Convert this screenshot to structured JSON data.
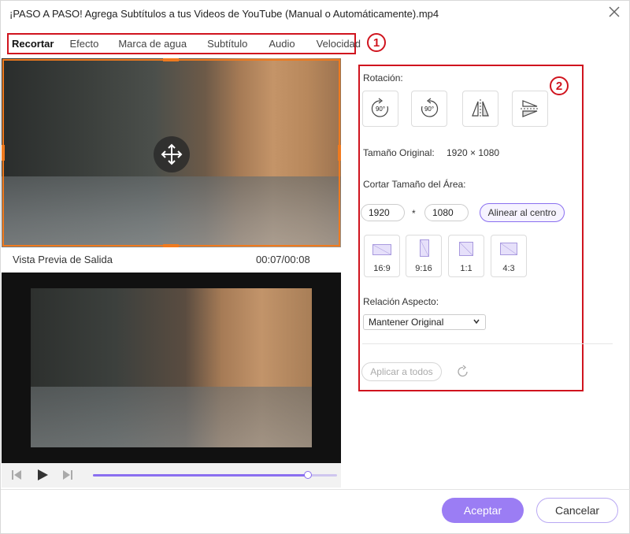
{
  "window": {
    "title": "¡PASO A PASO! Agrega Subtítulos a tus Videos de YouTube (Manual o Automáticamente).mp4",
    "close_icon": "close-icon"
  },
  "tabs": [
    {
      "label": "Recortar",
      "active": true
    },
    {
      "label": "Efecto",
      "active": false
    },
    {
      "label": "Marca de agua",
      "active": false
    },
    {
      "label": "Subtítulo",
      "active": false
    },
    {
      "label": "Audio",
      "active": false
    },
    {
      "label": "Velocidad",
      "active": false
    }
  ],
  "annotations": {
    "badge1": "1",
    "badge2": "2"
  },
  "preview": {
    "output_label": "Vista Previa de Salida",
    "time": "00:07/00:08",
    "progress_fraction": 0.88
  },
  "crop_panel": {
    "rotation_label": "Rotación:",
    "rotation_buttons": [
      {
        "icon": "rotate-right-90-icon"
      },
      {
        "icon": "rotate-left-90-icon"
      },
      {
        "icon": "flip-horizontal-icon"
      },
      {
        "icon": "flip-vertical-icon"
      }
    ],
    "original_size_label": "Tamaño Original:",
    "original_size_value": "1920 × 1080",
    "crop_area_label": "Cortar Tamaño del Área:",
    "width_value": "1920",
    "times_sign": "*",
    "height_value": "1080",
    "align_center_label": "Alinear al centro",
    "ratios": [
      {
        "label": "16:9"
      },
      {
        "label": "9:16"
      },
      {
        "label": "1:1"
      },
      {
        "label": "4:3"
      }
    ],
    "aspect_label": "Relación Aspecto:",
    "aspect_selected": "Mantener Original",
    "apply_all_label": "Aplicar a todos"
  },
  "footer": {
    "accept_label": "Aceptar",
    "cancel_label": "Cancelar"
  },
  "colors": {
    "accent": "#9b7df4",
    "annotation_red": "#d0141e",
    "crop_orange": "#f07a1e"
  }
}
